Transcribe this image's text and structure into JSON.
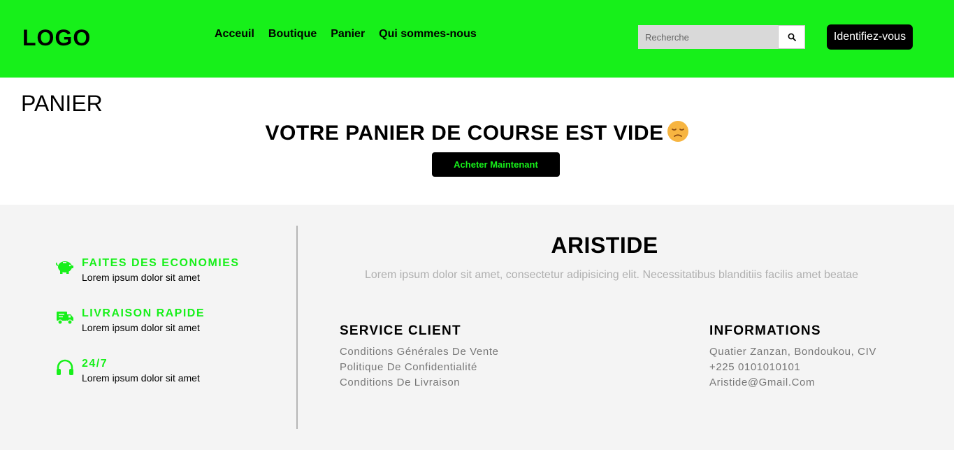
{
  "header": {
    "logo": "LOGO",
    "nav": [
      "Acceuil",
      "Boutique",
      "Panier",
      "Qui sommes-nous"
    ],
    "search_placeholder": "Recherche",
    "login_label": "Identifiez-vous",
    "accent_color": "#17f01a"
  },
  "cart": {
    "title": "PANIER",
    "empty_message": "VOTRE PANIER DE COURSE EST VIDE",
    "buy_button": "Acheter Maintenant"
  },
  "footer": {
    "features": [
      {
        "icon": "piggy-bank-icon",
        "title": "FAITES DES ECONOMIES",
        "desc": "Lorem ipsum dolor sit amet"
      },
      {
        "icon": "delivery-truck-icon",
        "title": "LIVRAISON RAPIDE",
        "desc": "Lorem ipsum dolor sit amet"
      },
      {
        "icon": "headphones-icon",
        "title": "24/7",
        "desc": "Lorem ipsum dolor sit amet"
      }
    ],
    "brand": "ARISTIDE",
    "brand_desc": "Lorem ipsum dolor sit amet, consectetur adipisicing elit. Necessitatibus blanditiis facilis amet beatae",
    "service": {
      "title": "SERVICE CLIENT",
      "links": [
        "Conditions Générales De Vente",
        "Politique De Confidentialité",
        "Conditions De Livraison"
      ]
    },
    "info": {
      "title": "INFORMATIONS",
      "lines": [
        "Quatier Zanzan, Bondoukou, CIV",
        "+225 0101010101",
        "Aristide@Gmail.Com"
      ]
    }
  }
}
